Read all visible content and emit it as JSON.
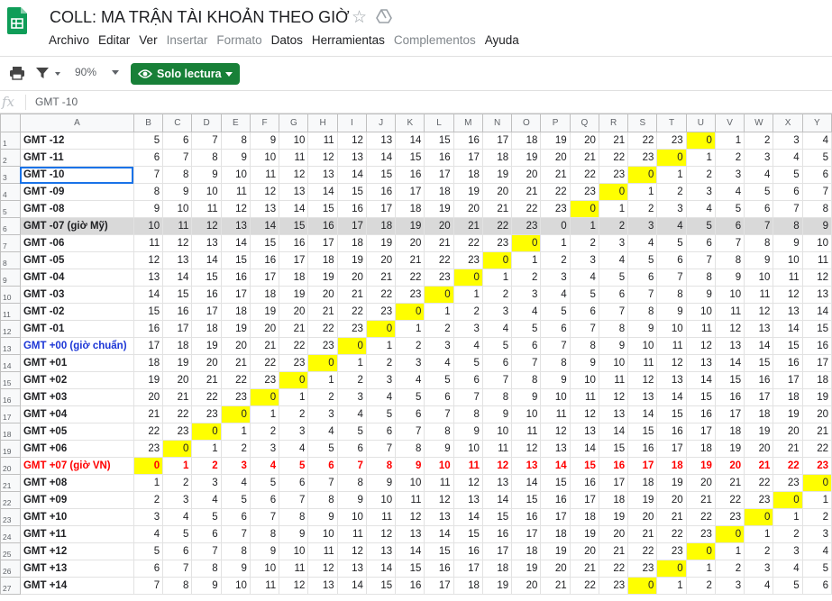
{
  "app": {
    "title": "COLL: MA TRẬN TÀI KHOẢN THEO GIỜ",
    "menu": [
      {
        "label": "Archivo",
        "disabled": false
      },
      {
        "label": "Editar",
        "disabled": false
      },
      {
        "label": "Ver",
        "disabled": false
      },
      {
        "label": "Insertar",
        "disabled": true
      },
      {
        "label": "Formato",
        "disabled": true
      },
      {
        "label": "Datos",
        "disabled": false
      },
      {
        "label": "Herramientas",
        "disabled": false
      },
      {
        "label": "Complementos",
        "disabled": true
      },
      {
        "label": "Ayuda",
        "disabled": false
      }
    ]
  },
  "toolbar": {
    "zoom": "90%",
    "readonly_label": "Solo lectura"
  },
  "formula_bar": {
    "fx": "fx",
    "value": "GMT -10"
  },
  "sheet": {
    "columns": [
      "A",
      "B",
      "C",
      "D",
      "E",
      "F",
      "G",
      "H",
      "I",
      "J",
      "K",
      "L",
      "M",
      "N",
      "O",
      "P",
      "Q",
      "R",
      "S",
      "T",
      "U",
      "V",
      "W",
      "X",
      "Y"
    ],
    "row_labels": [
      "GMT -12",
      "GMT -11",
      "GMT -10",
      "GMT -09",
      "GMT -08",
      "GMT -07 (giờ Mỹ)",
      "GMT -06",
      "GMT -05",
      "GMT -04",
      "GMT -03",
      "GMT -02",
      "GMT -01",
      "GMT +00 (giờ chuẩn)",
      "GMT +01",
      "GMT +02",
      "GMT +03",
      "GMT +04",
      "GMT +05",
      "GMT +06",
      "GMT +07 (giờ VN)",
      "GMT +08",
      "GMT +09",
      "GMT +10",
      "GMT +11",
      "GMT +12",
      "GMT +13",
      "GMT +14"
    ],
    "start_values": [
      5,
      6,
      7,
      8,
      9,
      10,
      11,
      12,
      13,
      14,
      15,
      16,
      17,
      18,
      19,
      20,
      21,
      22,
      23,
      0,
      1,
      2,
      3,
      4,
      5,
      6,
      7
    ],
    "special_rows": {
      "gray": 6,
      "blue": 13,
      "red": 20
    },
    "selected_row": 3,
    "colors": {
      "highlight": "#ffff00",
      "gray_row": "#d9d9d9",
      "vn_text": "#ff0000",
      "std_text": "#1c36d6",
      "button": "#188038"
    }
  }
}
